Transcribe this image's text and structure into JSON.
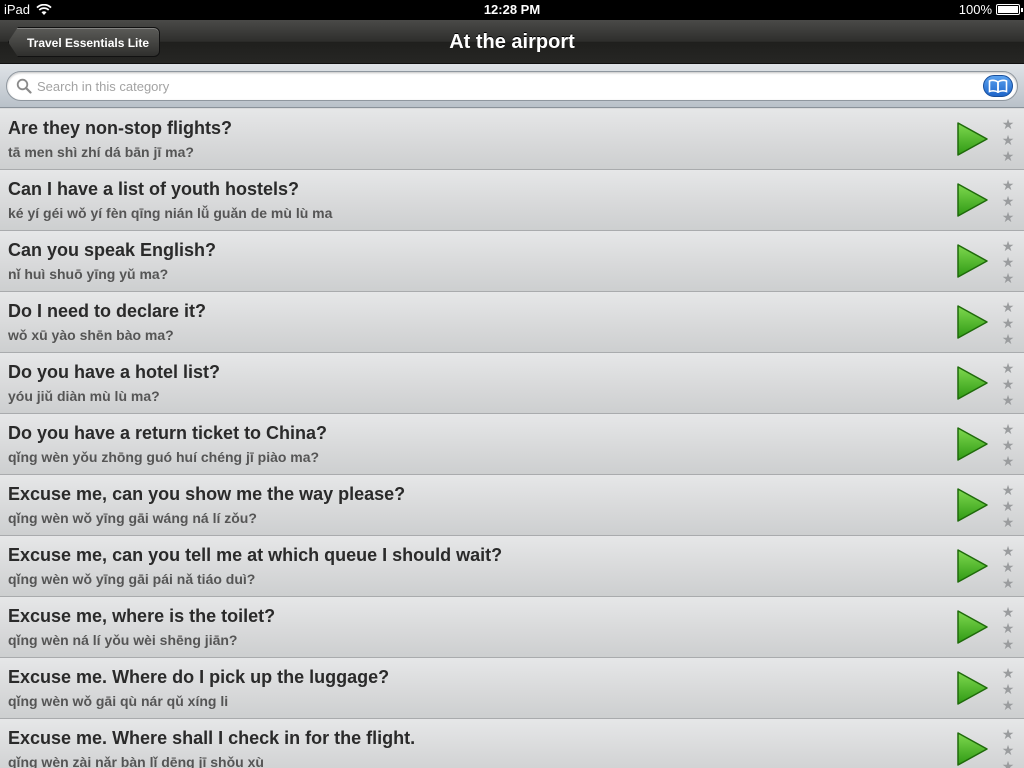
{
  "status_bar": {
    "device": "iPad",
    "time": "12:28 PM",
    "battery": "100%",
    "battery_level": 1.0
  },
  "nav": {
    "back_label": "Travel Essentials Lite",
    "title": "At the airport"
  },
  "search": {
    "placeholder": "Search in this category",
    "value": ""
  },
  "phrases": [
    {
      "english": "Are they non-stop flights?",
      "pinyin": "tā men shì zhí dá bān jī ma?"
    },
    {
      "english": "Can I have a list of youth hostels?",
      "pinyin": "ké yí géi wǒ yí fèn qīng nián lǚ guǎn de mù lù ma"
    },
    {
      "english": "Can you speak English?",
      "pinyin": "nǐ huì shuō yīng yǔ ma?"
    },
    {
      "english": "Do I need to declare it?",
      "pinyin": "wǒ xū yào shēn bào ma?"
    },
    {
      "english": "Do you have a hotel list?",
      "pinyin": "yóu jiǔ diàn mù lù ma?"
    },
    {
      "english": "Do you have a return ticket to China?",
      "pinyin": "qǐng wèn yǒu zhōng guó huí chéng jī piào ma?"
    },
    {
      "english": "Excuse me, can you show me the way please?",
      "pinyin": "qǐng wèn wǒ yīng gāi wáng ná lí zǒu?"
    },
    {
      "english": "Excuse me, can you tell me at which queue I should wait?",
      "pinyin": "qǐng wèn wǒ yīng gāi pái nǎ tiáo duì?"
    },
    {
      "english": "Excuse me, where is the toilet?",
      "pinyin": "qǐng wèn ná lí yǒu wèi shēng jiān?"
    },
    {
      "english": "Excuse me. Where do I pick up the luggage?",
      "pinyin": "qǐng wèn wǒ gāi qù nár qǔ xíng li"
    },
    {
      "english": "Excuse me. Where shall I check in for the flight.",
      "pinyin": "qǐng wèn zài nǎr bàn lǐ dēng jī shǒu xù"
    }
  ],
  "colors": {
    "play_green": "#3aa81e",
    "star_gray": "#9a9c9e",
    "nav_dark": "#2e2e2c"
  }
}
